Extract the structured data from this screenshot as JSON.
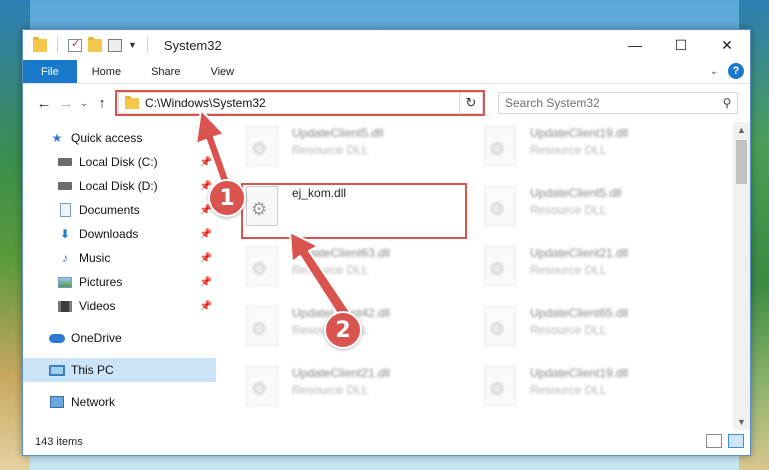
{
  "titlebar": {
    "title": "System32",
    "minimize": "—",
    "maximize": "☐",
    "close": "✕"
  },
  "ribbon": {
    "tabs": [
      "File",
      "Home",
      "Share",
      "View"
    ],
    "help": "?",
    "collapse": "⌄"
  },
  "nav": {
    "back": "←",
    "forward": "→",
    "recent": "⌄",
    "up": "↑",
    "address": "C:\\Windows\\System32",
    "dropdown": "⌄",
    "refresh": "↻",
    "search_placeholder": "Search System32",
    "search_icon": "⚲"
  },
  "sidebar": {
    "items": [
      {
        "label": "Quick access",
        "icon": "star-icon"
      },
      {
        "label": "Local Disk (C:)",
        "icon": "drive-icon",
        "pinned": true
      },
      {
        "label": "Local Disk (D:)",
        "icon": "drive-icon",
        "pinned": true
      },
      {
        "label": "Documents",
        "icon": "documents-icon",
        "pinned": true
      },
      {
        "label": "Downloads",
        "icon": "downloads-icon",
        "pinned": true
      },
      {
        "label": "Music",
        "icon": "music-icon",
        "pinned": true
      },
      {
        "label": "Pictures",
        "icon": "pictures-icon",
        "pinned": true
      },
      {
        "label": "Videos",
        "icon": "videos-icon",
        "pinned": true
      },
      {
        "label": "OneDrive",
        "icon": "onedrive-icon"
      },
      {
        "label": "This PC",
        "icon": "this-pc-icon",
        "selected": true
      },
      {
        "label": "Network",
        "icon": "network-icon"
      }
    ]
  },
  "files": {
    "left_column": [
      {
        "name": "UpdateClient5.dll",
        "type": "Resource DLL"
      },
      {
        "name": "ej_kom.dll",
        "type": ""
      },
      {
        "name": "UpdateClient63.dll",
        "type": "Resource DLL"
      },
      {
        "name": "UpdateClient42.dll",
        "type": "Resource DLL"
      },
      {
        "name": "UpdateClient21.dll",
        "type": "Resource DLL"
      }
    ],
    "right_column": [
      {
        "name": "UpdateClient19.dll",
        "type": "Resource DLL"
      },
      {
        "name": "UpdateClient5.dll",
        "type": "Resource DLL"
      },
      {
        "name": "UpdateClient21.dll",
        "type": "Resource DLL"
      },
      {
        "name": "UpdateClient65.dll",
        "type": "Resource DLL"
      },
      {
        "name": "UpdateClient19.dll",
        "type": "Resource DLL"
      }
    ]
  },
  "callouts": {
    "one": "1",
    "two": "2",
    "color": "#d9534f"
  },
  "status": {
    "items": "143 items"
  },
  "colors": {
    "accent": "#1979ca",
    "selected": "#cce4f7",
    "highlight": "#d9534f"
  }
}
